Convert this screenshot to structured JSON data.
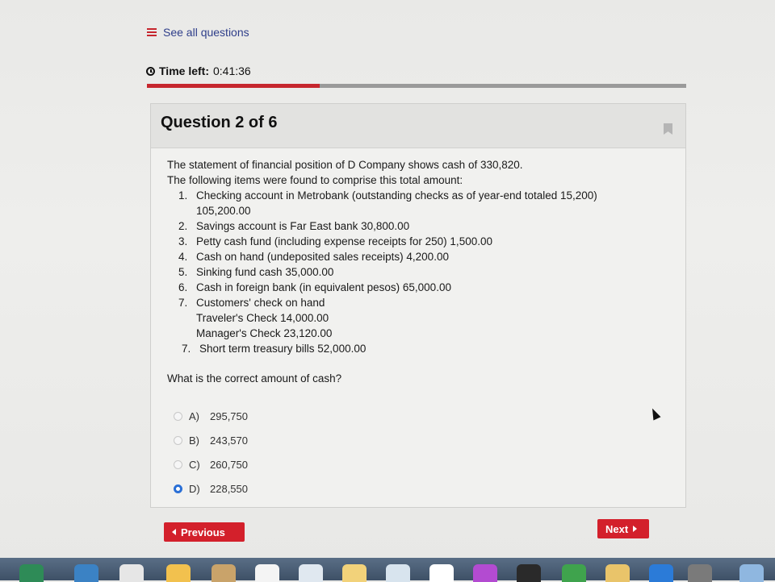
{
  "nav": {
    "see_all_label": "See all questions"
  },
  "timer": {
    "label": "Time left:",
    "value": "0:41:36",
    "elapsed_fraction": 0.32
  },
  "question": {
    "title": "Question 2 of 6",
    "intro_1": "The statement of financial position of D Company shows cash of 330,820.",
    "intro_2": "The following items were found to comprise this total amount:",
    "items": [
      {
        "num": "1.",
        "text": "Checking account in Metrobank (outstanding checks as of year-end totaled 15,200) 105,200.00"
      },
      {
        "num": "2.",
        "text": "Savings account is Far East bank 30,800.00"
      },
      {
        "num": "3.",
        "text": "Petty cash fund (including expense receipts for 250) 1,500.00"
      },
      {
        "num": "4.",
        "text": "Cash on hand (undeposited sales receipts) 4,200.00"
      },
      {
        "num": "5.",
        "text": "Sinking fund cash 35,000.00"
      },
      {
        "num": "6.",
        "text": "Cash in foreign bank (in equivalent pesos) 65,000.00"
      },
      {
        "num": "7.",
        "text": "Customers' check on hand"
      }
    ],
    "sub_lines": [
      "Traveler's Check 14,000.00",
      "Manager's Check 23,120.00"
    ],
    "item_last": {
      "num": "7.",
      "text": "Short term treasury bills 52,000.00"
    },
    "prompt": "What is the correct amount of cash?"
  },
  "options": [
    {
      "letter": "A)",
      "value": "295,750",
      "selected": false
    },
    {
      "letter": "B)",
      "value": "243,570",
      "selected": false
    },
    {
      "letter": "C)",
      "value": "260,750",
      "selected": false
    },
    {
      "letter": "D)",
      "value": "228,550",
      "selected": true
    }
  ],
  "buttons": {
    "previous": "Previous",
    "next": "Next"
  },
  "colors": {
    "accent": "#d3202b",
    "radio_selected": "#2a6fd6"
  }
}
